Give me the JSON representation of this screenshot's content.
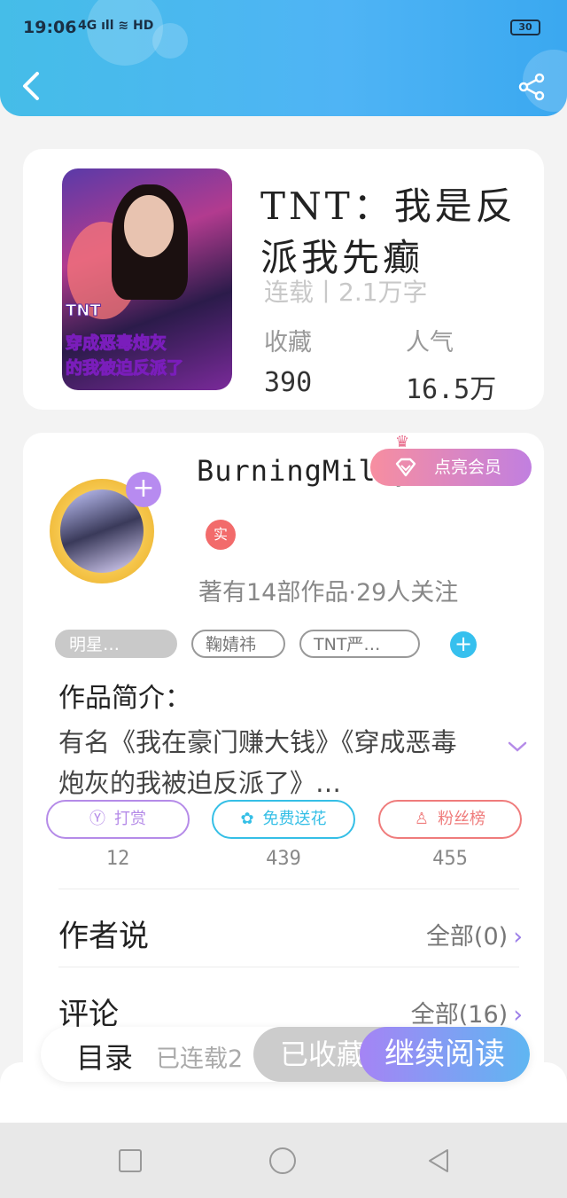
{
  "status_bar": {
    "time": "19:06",
    "signal": "4G ıll ≋ HD",
    "battery": "30"
  },
  "book": {
    "title": "TNT：我是反派我先癫",
    "cover_tag": "TNT",
    "cover_line1": "穿成恶毒炮灰",
    "cover_line2": "的我被迫反派了",
    "serial_info": "连载丨2.1万字",
    "favorites_label": "收藏",
    "favorites_value": "390",
    "popularity_label": "人气",
    "popularity_value": "16.5万"
  },
  "author": {
    "name": "BurningMilky",
    "vip_label": "点亮会员",
    "verified_badge": "实",
    "works_info": "著有14部作品·29人关注",
    "tags": [
      "明星…",
      "鞠婧祎",
      "TNT严…"
    ],
    "intro_heading": "作品简介：",
    "intro_text": "有名《我在豪门赚大钱》《穿成恶毒炮灰的我被迫反派了》…"
  },
  "actions": [
    {
      "label": "打赏",
      "count": "12",
      "icon": "yen-icon",
      "color": "#b58be8"
    },
    {
      "label": "免费送花",
      "count": "439",
      "icon": "flower-icon",
      "color": "#35bfe6"
    },
    {
      "label": "粉丝榜",
      "count": "455",
      "icon": "fans-icon",
      "color": "#ef7c7c"
    }
  ],
  "author_says": {
    "label": "作者说",
    "link": "全部(0)"
  },
  "comments": {
    "label": "评论",
    "link": "全部(16)"
  },
  "bottom_bar": {
    "toc_label": "目录",
    "serial_count": "已连载2",
    "collected_label": "已收藏",
    "continue_label": "继续阅读"
  },
  "colors": {
    "header": "#4fb4f5",
    "accent_purple": "#a584f5",
    "accent_blue": "#5fb6f2"
  }
}
